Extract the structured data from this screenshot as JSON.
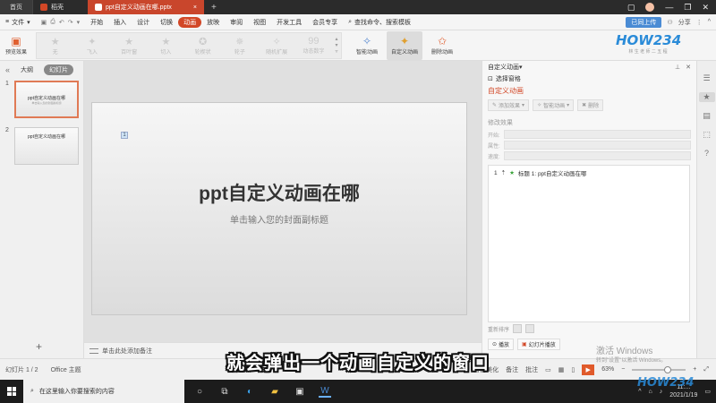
{
  "tabs": {
    "home": "首页",
    "docer": "稻壳",
    "doc": "ppt自定义动画在哪.pptx",
    "plus": "+"
  },
  "window": {
    "sync": "已同步",
    "share": "分享"
  },
  "menu": {
    "file": "文件",
    "items": [
      "开始",
      "插入",
      "设计",
      "切换",
      "动画",
      "放映",
      "审阅",
      "视图",
      "开发工具",
      "会员专享"
    ],
    "active_index": 4,
    "search": "查找命令、搜索模板",
    "sync_upload": "已同上传",
    "share": "分享"
  },
  "ribbon": {
    "preview": "预览效果",
    "gallery": [
      "无",
      "飞入",
      "百叶窗",
      "切入",
      "轮楔状",
      "轮子",
      "随机扩展",
      "动态数字"
    ],
    "smart_anim": "智能动画",
    "custom_anim": "自定义动画",
    "delete_anim": "删除动画"
  },
  "brand": {
    "name": "HOW234",
    "sub": "林 生 老 师 二 五 程"
  },
  "left": {
    "tab_outline": "大纲",
    "tab_slides": "幻灯片",
    "slides": [
      {
        "num": "1",
        "title": "ppt自定义动画在哪",
        "sub": "单击输入您的封面副标题"
      },
      {
        "num": "2",
        "title": "ppt自定义动画在哪",
        "sub": ""
      }
    ],
    "add": "+"
  },
  "slide": {
    "marker": "1",
    "title": "ppt自定义动画在哪",
    "subtitle": "单击输入您的封面副标题"
  },
  "notes": "单击此处添加备注",
  "pane": {
    "header": "自定义动画",
    "select_pane": "选择窗格",
    "title": "自定义动画",
    "add_effect": "添加效果",
    "smart_anim": "智能动画",
    "delete": "删除",
    "modify": "修改效果",
    "start": "开始:",
    "property": "属性:",
    "speed": "速度:",
    "item": {
      "num": "1",
      "label": "标题 1: ppt自定义动画在哪"
    },
    "reorder": "重新排序",
    "play": "播放",
    "slideshow": "幻灯片播放"
  },
  "status": {
    "slide": "幻灯片 1 / 2",
    "theme": "Office 主题",
    "smart_beautify": "智能美化",
    "notes": "备注",
    "comments": "批注",
    "zoom": "63%"
  },
  "caption": "就会弹出一个动画自定义的窗口",
  "activate": {
    "line1": "激活 Windows",
    "line2": "转到\"设置\"以激活 Windows。"
  },
  "taskbar": {
    "search_placeholder": "在这里输入你要搜索的内容",
    "time": "11:...",
    "date": "2021/1/19"
  }
}
